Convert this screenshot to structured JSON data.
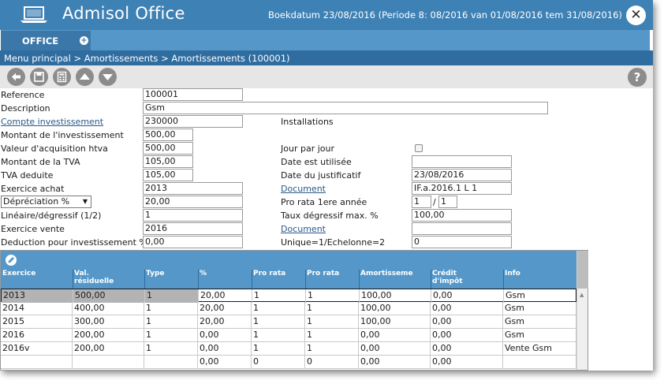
{
  "app": {
    "title": "Admisol Office",
    "boekdatum": "Boekdatum 23/08/2016 (Periode 8: 08/2016 van 01/08/2016 tem 31/08/2016)"
  },
  "tabs": [
    {
      "label": "OFFICE"
    }
  ],
  "breadcrumb": "Menu principal > Amortissements > Amortissements (100001)",
  "toolbar": {
    "icons": [
      "back-icon",
      "save-icon",
      "calculator-icon",
      "up-icon",
      "down-icon",
      "help-icon"
    ],
    "help_label": "?"
  },
  "form": {
    "reference": {
      "label": "Reference",
      "value": "100001"
    },
    "description": {
      "label": "Description",
      "value": "Gsm"
    },
    "compte": {
      "label": "Compte investissement",
      "value": "230000",
      "desc": "Installations"
    },
    "montant_invest": {
      "label": "Montant de l'investissement",
      "value": "500,00"
    },
    "valeur_acq": {
      "label": "Valeur d'acquisition htva",
      "value": "500,00"
    },
    "montant_tva": {
      "label": "Montant de la TVA",
      "value": "105,00"
    },
    "tva_deduite": {
      "label": "TVA deduite",
      "value": "105,00"
    },
    "exercice_achat": {
      "label": "Exercice achat",
      "value": "2013"
    },
    "depreciation": {
      "label": "Dépréciation %",
      "value": "20,00"
    },
    "lineaire": {
      "label": "Linéaire/dégressif (1/2)",
      "value": "1"
    },
    "exercice_vente": {
      "label": "Exercice vente",
      "value": "2016"
    },
    "deduction": {
      "label": "Deduction pour investissement %",
      "value": "0,00"
    },
    "jour_par_jour": {
      "label": "Jour par jour"
    },
    "date_utilisee": {
      "label": "Date est utilisée",
      "value": ""
    },
    "date_justificatif": {
      "label": "Date du justificatif",
      "value": "23/08/2016"
    },
    "document1": {
      "label": "Document",
      "value": "IF.a.2016.1 L 1"
    },
    "pro_rata": {
      "label": "Pro rata 1ere année",
      "value1": "1",
      "sep": "/",
      "value2": "1"
    },
    "taux_degressif": {
      "label": "Taux dégressif max. %",
      "value": "100,00"
    },
    "document2": {
      "label": "Document",
      "value": ""
    },
    "unique": {
      "label": "Unique=1/Echelonne=2",
      "value": "0"
    }
  },
  "grid": {
    "headers": [
      "Exercice",
      "Val. résiduelle",
      "Type",
      "%",
      "Pro rata",
      "Pro rata",
      "Amortisseme",
      "Crédit d'impôt",
      "Info"
    ],
    "rows": [
      [
        "2013",
        "500,00",
        "1",
        "20,00",
        "1",
        "1",
        "100,00",
        "0,00",
        "Gsm"
      ],
      [
        "2014",
        "400,00",
        "1",
        "20,00",
        "1",
        "1",
        "100,00",
        "0,00",
        "Gsm"
      ],
      [
        "2015",
        "300,00",
        "1",
        "20,00",
        "1",
        "1",
        "100,00",
        "0,00",
        "Gsm"
      ],
      [
        "2016",
        "200,00",
        "1",
        "0,00",
        "1",
        "1",
        "0,00",
        "0,00",
        "Gsm"
      ],
      [
        "2016v",
        "200,00",
        "1",
        "0,00",
        "1",
        "1",
        "0,00",
        "0,00",
        "Vente Gsm"
      ],
      [
        "",
        "",
        "",
        "0,00",
        "0",
        "0",
        "0,00",
        "0,00",
        ""
      ]
    ]
  },
  "colors": {
    "titlebar": "#3e81b5",
    "tab": "#3b78a9",
    "breadcrumb": "#2f6c9f",
    "grid_header": "#5497c8"
  }
}
